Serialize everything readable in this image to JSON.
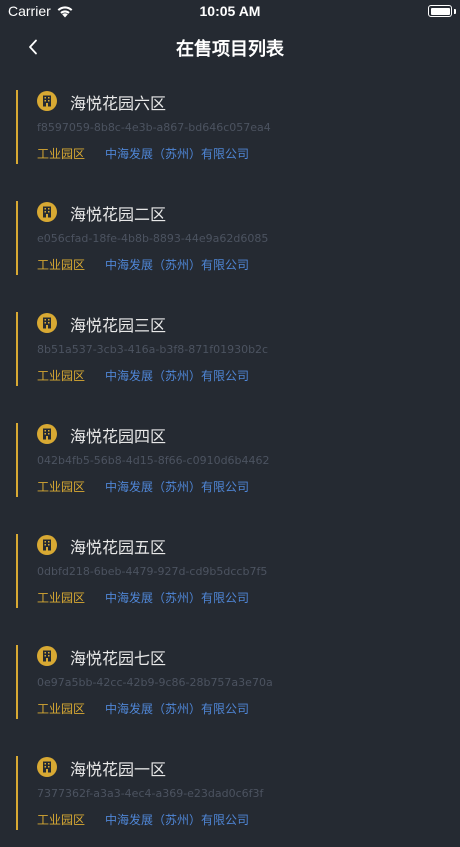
{
  "status_bar": {
    "carrier": "Carrier",
    "time": "10:05 AM"
  },
  "nav": {
    "title": "在售项目列表"
  },
  "colors": {
    "background": "#252a32",
    "accent_gold": "#d8a933",
    "company_blue": "#4f86d6",
    "id_gray": "#4c5360"
  },
  "projects": [
    {
      "name": "海悦花园六区",
      "id": "f8597059-8b8c-4e3b-a867-bd646c057ea4",
      "tag": "工业园区",
      "company": "中海发展（苏州）有限公司"
    },
    {
      "name": "海悦花园二区",
      "id": "e056cfad-18fe-4b8b-8893-44e9a62d6085",
      "tag": "工业园区",
      "company": "中海发展（苏州）有限公司"
    },
    {
      "name": "海悦花园三区",
      "id": "8b51a537-3cb3-416a-b3f8-871f01930b2c",
      "tag": "工业园区",
      "company": "中海发展（苏州）有限公司"
    },
    {
      "name": "海悦花园四区",
      "id": "042b4fb5-56b8-4d15-8f66-c0910d6b4462",
      "tag": "工业园区",
      "company": "中海发展（苏州）有限公司"
    },
    {
      "name": "海悦花园五区",
      "id": "0dbfd218-6beb-4479-927d-cd9b5dccb7f5",
      "tag": "工业园区",
      "company": "中海发展（苏州）有限公司"
    },
    {
      "name": "海悦花园七区",
      "id": "0e97a5bb-42cc-42b9-9c86-28b757a3e70a",
      "tag": "工业园区",
      "company": "中海发展（苏州）有限公司"
    },
    {
      "name": "海悦花园一区",
      "id": "7377362f-a3a3-4ec4-a369-e23dad0c6f3f",
      "tag": "工业园区",
      "company": "中海发展（苏州）有限公司"
    }
  ]
}
